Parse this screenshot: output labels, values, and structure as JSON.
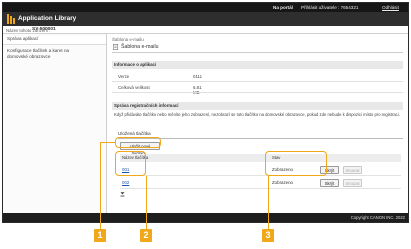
{
  "topbar": {
    "portal_label": "Na portál",
    "user_label": "Přihlásit uživatele : 7654321",
    "logout_label": "Odhlásit"
  },
  "appbar": {
    "title": "Application Library"
  },
  "device": {
    "label": "Název tohoto zařízení :",
    "value": "SY 500001"
  },
  "sidebar": {
    "items": [
      {
        "label": "Správa aplikací"
      },
      {
        "label": "Konfigurace tlačítek a karet na"
      },
      {
        "label": "domovské obrazovce"
      }
    ]
  },
  "main": {
    "breadcrumb": "Šablona e-mailu",
    "heading": "Šablona e-mailu",
    "info_section": {
      "title": "Informace o aplikaci",
      "rows": [
        {
          "key": "Verze",
          "value": "0111"
        },
        {
          "key": "Celková velikost",
          "value": "6.81 MB"
        }
      ]
    },
    "register_section": {
      "title": "Správa registračních informací",
      "description": "Když přidáváte tlačítko nebo měníte jeho zobrazení, nezobrazí se toto tlačítko na domovské obrazovce, pokud zde nebude k dispozici místo pro registraci."
    },
    "saved_buttons": {
      "subtitle": "Uložená tlačítka",
      "save_new_label": "Uložit nové tlačítko...",
      "col_name": "Název tlačítka",
      "col_state": "Stav",
      "rows": [
        {
          "name": "001",
          "state": "Zobrazeno",
          "hide": "Skrýt",
          "delete": "Smazat"
        },
        {
          "name": "002",
          "state": "Zobrazeno",
          "hide": "Skrýt",
          "delete": "Smazat"
        }
      ]
    }
  },
  "footer": {
    "copyright": "Copyright CANON INC. 2022"
  },
  "callouts": [
    "1",
    "2",
    "3"
  ],
  "colors": {
    "accent": "#f0a81a",
    "topbar": "#161616",
    "appbar": "#2e2e2e",
    "link": "#1a56b8"
  }
}
